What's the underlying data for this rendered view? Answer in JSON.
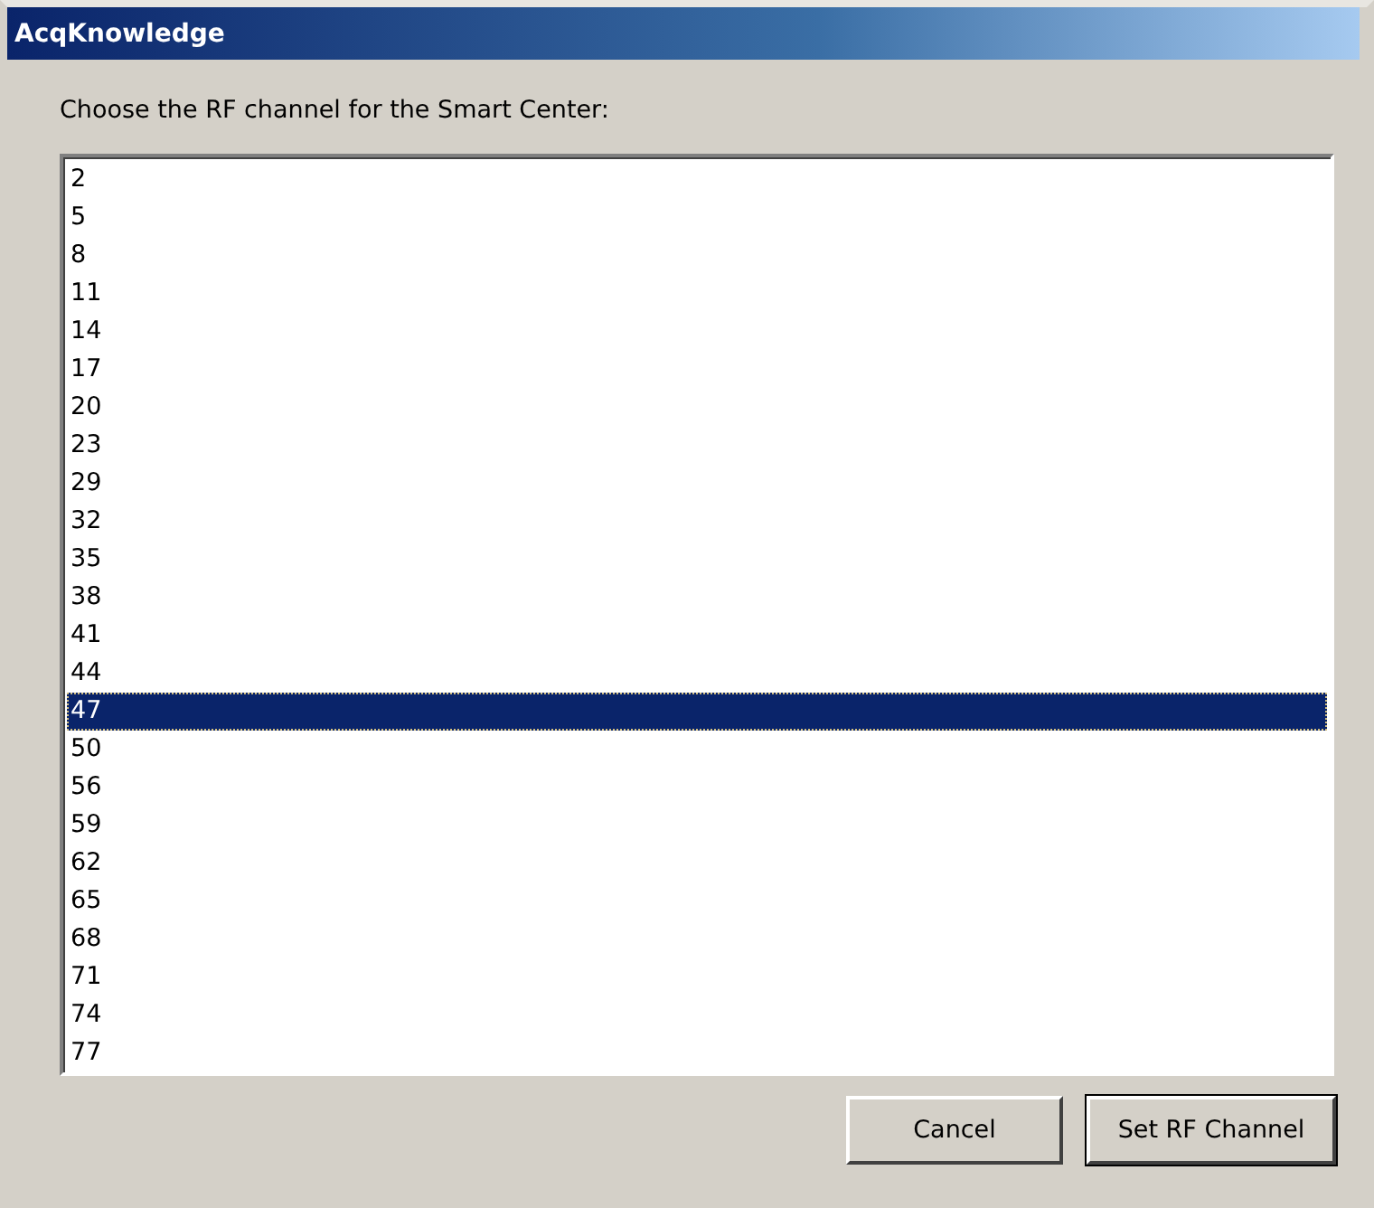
{
  "window": {
    "title": "AcqKnowledge"
  },
  "prompt": "Choose the RF channel for the Smart Center:",
  "channels": [
    {
      "label": "2",
      "selected": false
    },
    {
      "label": "5",
      "selected": false
    },
    {
      "label": "8",
      "selected": false
    },
    {
      "label": "11",
      "selected": false
    },
    {
      "label": "14",
      "selected": false
    },
    {
      "label": "17",
      "selected": false
    },
    {
      "label": "20",
      "selected": false
    },
    {
      "label": "23",
      "selected": false
    },
    {
      "label": "29",
      "selected": false
    },
    {
      "label": "32",
      "selected": false
    },
    {
      "label": "35",
      "selected": false
    },
    {
      "label": "38",
      "selected": false
    },
    {
      "label": "41",
      "selected": false
    },
    {
      "label": "44",
      "selected": false
    },
    {
      "label": "47",
      "selected": true
    },
    {
      "label": "50",
      "selected": false
    },
    {
      "label": "56",
      "selected": false
    },
    {
      "label": "59",
      "selected": false
    },
    {
      "label": "62",
      "selected": false
    },
    {
      "label": "65",
      "selected": false
    },
    {
      "label": "68",
      "selected": false
    },
    {
      "label": "71",
      "selected": false
    },
    {
      "label": "74",
      "selected": false
    },
    {
      "label": "77",
      "selected": false
    }
  ],
  "buttons": [
    {
      "label": "Cancel",
      "default": false
    },
    {
      "label": "Set RF Channel",
      "default": true
    }
  ]
}
